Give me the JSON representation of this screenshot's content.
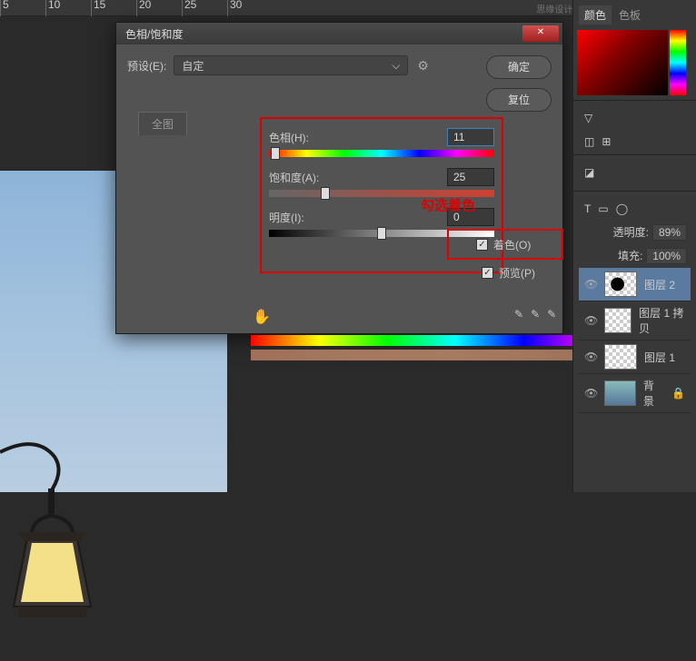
{
  "ruler": [
    "5",
    "10",
    "15",
    "20",
    "25",
    "30"
  ],
  "watermark": "思缘设计论坛 WWW.MISSYUAN.COM",
  "dialog": {
    "title": "色相/饱和度",
    "preset_label": "预设(E):",
    "preset_value": "自定",
    "ok": "确定",
    "reset": "复位",
    "tab_all": "全图",
    "hue_label": "色相(H):",
    "hue_value": "11",
    "sat_label": "饱和度(A):",
    "sat_value": "25",
    "light_label": "明度(I):",
    "light_value": "0",
    "colorize_label": "着色(O)",
    "preview_label": "预览(P)"
  },
  "annotation": "勾选着色",
  "panels": {
    "color_tab1": "颜色",
    "color_tab2": "色板",
    "opacity_label": "透明度:",
    "opacity_value": "89%",
    "fill_label": "填充:",
    "fill_value": "100%"
  },
  "layers": [
    {
      "name": "图层 2"
    },
    {
      "name": "图层 1 拷贝"
    },
    {
      "name": "图层 1"
    },
    {
      "name": "背景"
    }
  ]
}
